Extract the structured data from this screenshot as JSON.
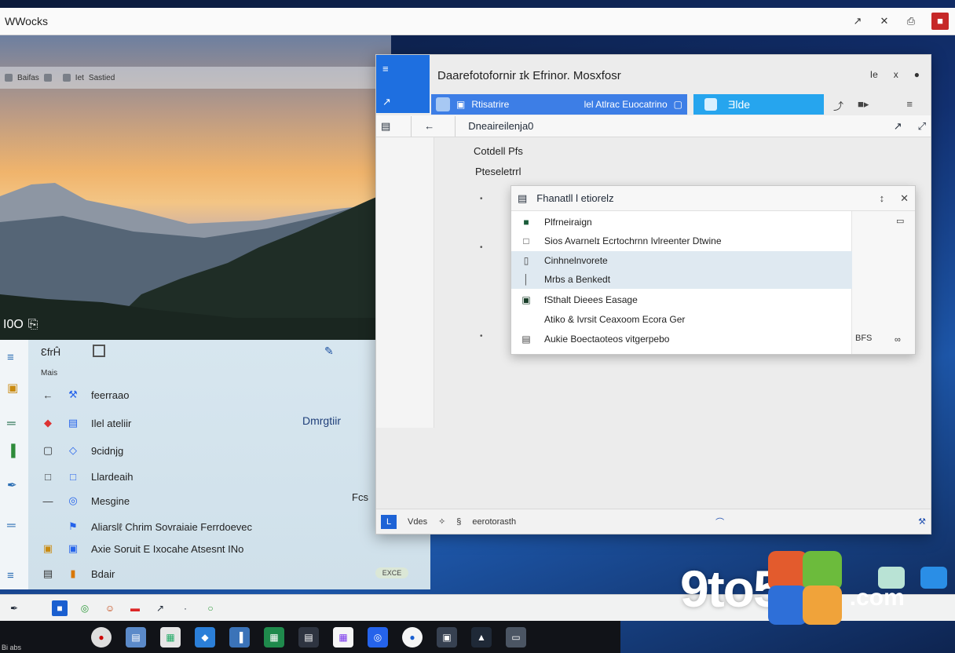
{
  "app": {
    "title": "WWocks",
    "controls": [
      "↗",
      "✕",
      "⎙",
      "■"
    ]
  },
  "photo": {
    "overlay_items": [
      "Baifas",
      "Iet",
      "Sastied"
    ],
    "badge": "I0O"
  },
  "left_panel": {
    "header": "ƐfrĤ",
    "sub": "Mais",
    "side_label": "Dmrgtiir",
    "side_label2": "Fcs",
    "pill": "EXCE",
    "rows": [
      {
        "label": "feerraao"
      },
      {
        "label": "Ilel ateliir"
      },
      {
        "label": "9cidnjg"
      },
      {
        "label": "Llardeaih"
      },
      {
        "label": "Mesgine"
      },
      {
        "label": "Aliarslℓ Chrim Sovraiaie Ferrdoevec"
      },
      {
        "label": "Axie Soruit  E Ixocahe Atsesnt INo"
      },
      {
        "label": "Bdair"
      }
    ]
  },
  "window": {
    "title": "Daarefotofornir  ɪk Efrinor. Mosxfosr",
    "controls": [
      "Ie",
      "x",
      "●"
    ],
    "tab1": {
      "left": "Rtisatrire",
      "right": "lel Atlrac Euocatrino"
    },
    "tab2": {
      "label": "Ǝlde"
    },
    "address": "Dneaireilenja0",
    "crumb1": "Cotdell Pfs",
    "crumb2": "Pteseletrrl",
    "footer": {
      "icon": "L",
      "label": "Vdes",
      "text": "eerotorasth"
    }
  },
  "dropdown": {
    "header": "Fhanatll Ɩ etiorelz",
    "side_value": "BFS",
    "items": [
      {
        "label": "Plfrneiraign"
      },
      {
        "label": "Sios Avarnelɪ Ecrtochrnn Ivlreenter Dtwine"
      },
      {
        "label": "Cinhnelnvorete"
      },
      {
        "label": "Mrbs a Benkedt"
      },
      {
        "label": "fSthalt Dieees Easage"
      },
      {
        "label": "Atiko & Ivrsit Ceaxoom Ecora Ger"
      },
      {
        "label": "Aukie Boectaoteos vitgerpebo"
      }
    ]
  },
  "taskbar": {
    "label": "Bi abs"
  },
  "brand": {
    "name": "9to5",
    "suffix": ".com"
  },
  "colors": {
    "accent": "#1e6fe0",
    "tab_blue": "#26a5ee",
    "close_red": "#c62828"
  }
}
